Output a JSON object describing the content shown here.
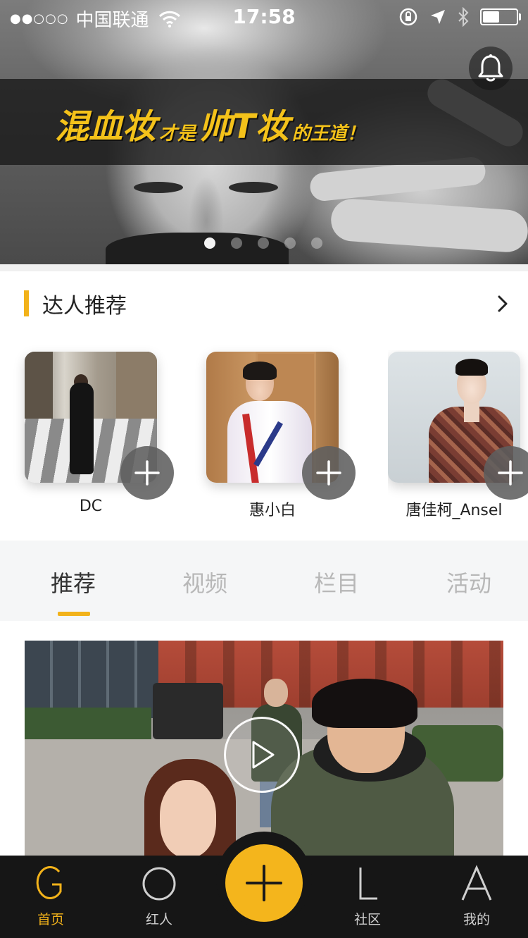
{
  "status_bar": {
    "signal_dots": "●●○○○",
    "carrier": "中国联通",
    "time": "17:58",
    "battery_level": 0.45
  },
  "banner": {
    "part1": "混血妆",
    "part2": "才是",
    "part3": "帅T妆",
    "part4": "的王道！",
    "active_slide": 1,
    "slide_count": 5
  },
  "experts_section": {
    "title": "达人推荐",
    "items": [
      {
        "name": "DC"
      },
      {
        "name": "惠小白"
      },
      {
        "name": "唐佳柯_Ansel"
      }
    ]
  },
  "tabs": [
    {
      "label": "推荐",
      "active": true
    },
    {
      "label": "视频",
      "active": false
    },
    {
      "label": "栏目",
      "active": false
    },
    {
      "label": "活动",
      "active": false
    }
  ],
  "bottom_nav": [
    {
      "label": "首页",
      "icon": "home-g-icon",
      "active": true
    },
    {
      "label": "红人",
      "icon": "circle-icon",
      "active": false
    },
    {
      "label": "社区",
      "icon": "community-l-icon",
      "active": false
    },
    {
      "label": "我的",
      "icon": "profile-a-icon",
      "active": false
    }
  ],
  "colors": {
    "accent": "#f2b21a",
    "banner_text": "#f4c21a",
    "nav_bg": "#161616",
    "tabs_bg": "#f5f6f7"
  }
}
